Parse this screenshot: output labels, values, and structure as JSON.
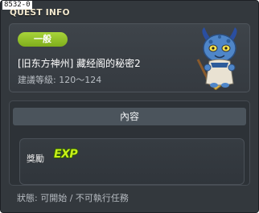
{
  "window": {
    "debug_id": "8532-0",
    "title": "QUEST INFO",
    "close_symbol": "×"
  },
  "quest": {
    "category_badge": "一般",
    "name": "[旧东方神州] 藏经阁的秘密2",
    "level_range": "建議等級: 120～124"
  },
  "content": {
    "header": "內容",
    "reward_label": "獎勵",
    "reward_icon": "EXP"
  },
  "status": "狀態: 可開始 / 不可執行任務",
  "icons": {
    "monster": "blue-horned-monster-icon",
    "exp": "exp-icon"
  },
  "colors": {
    "window_bg": "#33383d",
    "badge_green": "#8fc02a",
    "exp_green": "#c8f018",
    "title_text": "#f4ead0"
  }
}
